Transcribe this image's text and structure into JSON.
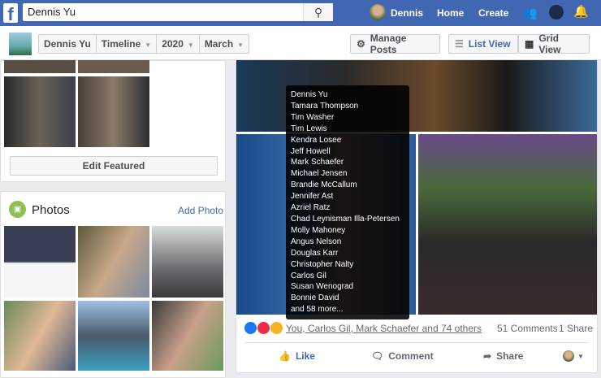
{
  "topbar": {
    "search_value": "Dennis Yu",
    "user_name": "Dennis",
    "home": "Home",
    "create": "Create"
  },
  "subbar": {
    "profile_name": "Dennis Yu",
    "timeline": "Timeline",
    "year": "2020",
    "month": "March",
    "manage_posts": "Manage Posts",
    "list_view": "List View",
    "grid_view": "Grid View"
  },
  "featured": {
    "edit_label": "Edit Featured"
  },
  "photos": {
    "title": "Photos",
    "add_label": "Add Photo"
  },
  "tooltip": {
    "names": [
      "Dennis Yu",
      "Tamara Thompson",
      "Tim Washer",
      "Tim Lewis",
      "Kendra Losee",
      "Jeff Howell",
      "Mark Schaefer",
      "Michael Jensen",
      "Brandie McCallum",
      "Jennifer Ast",
      "Azriel Ratz",
      "Chad Leynisman Illa-Petersen",
      "Molly Mahoney",
      "Angus Nelson",
      "Douglas Karr",
      "Christopher Nalty",
      "Carlos Gil",
      "Susan Wenograd",
      "Bonnie David",
      "and 58 more..."
    ]
  },
  "post": {
    "reactions_text": "You, Carlos Gil, Mark Schaefer and 74 others",
    "comments": "51 Comments",
    "shares": "1 Share",
    "like": "Like",
    "comment": "Comment",
    "share": "Share"
  },
  "colors": {
    "brand": "#4267b2",
    "background": "#e9ebee",
    "like_blue": "#4267b2"
  }
}
